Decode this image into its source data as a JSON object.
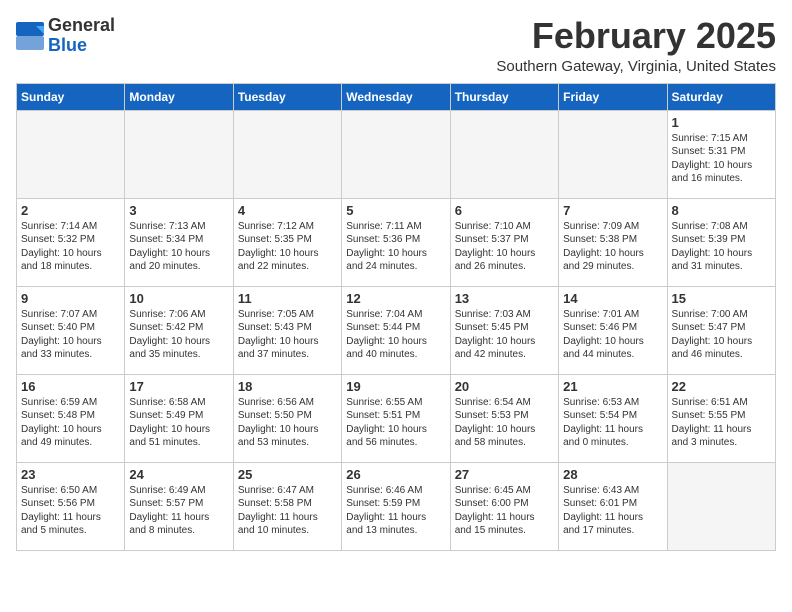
{
  "header": {
    "logo_line1": "General",
    "logo_line2": "Blue",
    "month_title": "February 2025",
    "location": "Southern Gateway, Virginia, United States"
  },
  "days_of_week": [
    "Sunday",
    "Monday",
    "Tuesday",
    "Wednesday",
    "Thursday",
    "Friday",
    "Saturday"
  ],
  "weeks": [
    [
      {
        "day": "",
        "info": ""
      },
      {
        "day": "",
        "info": ""
      },
      {
        "day": "",
        "info": ""
      },
      {
        "day": "",
        "info": ""
      },
      {
        "day": "",
        "info": ""
      },
      {
        "day": "",
        "info": ""
      },
      {
        "day": "1",
        "info": "Sunrise: 7:15 AM\nSunset: 5:31 PM\nDaylight: 10 hours\nand 16 minutes."
      }
    ],
    [
      {
        "day": "2",
        "info": "Sunrise: 7:14 AM\nSunset: 5:32 PM\nDaylight: 10 hours\nand 18 minutes."
      },
      {
        "day": "3",
        "info": "Sunrise: 7:13 AM\nSunset: 5:34 PM\nDaylight: 10 hours\nand 20 minutes."
      },
      {
        "day": "4",
        "info": "Sunrise: 7:12 AM\nSunset: 5:35 PM\nDaylight: 10 hours\nand 22 minutes."
      },
      {
        "day": "5",
        "info": "Sunrise: 7:11 AM\nSunset: 5:36 PM\nDaylight: 10 hours\nand 24 minutes."
      },
      {
        "day": "6",
        "info": "Sunrise: 7:10 AM\nSunset: 5:37 PM\nDaylight: 10 hours\nand 26 minutes."
      },
      {
        "day": "7",
        "info": "Sunrise: 7:09 AM\nSunset: 5:38 PM\nDaylight: 10 hours\nand 29 minutes."
      },
      {
        "day": "8",
        "info": "Sunrise: 7:08 AM\nSunset: 5:39 PM\nDaylight: 10 hours\nand 31 minutes."
      }
    ],
    [
      {
        "day": "9",
        "info": "Sunrise: 7:07 AM\nSunset: 5:40 PM\nDaylight: 10 hours\nand 33 minutes."
      },
      {
        "day": "10",
        "info": "Sunrise: 7:06 AM\nSunset: 5:42 PM\nDaylight: 10 hours\nand 35 minutes."
      },
      {
        "day": "11",
        "info": "Sunrise: 7:05 AM\nSunset: 5:43 PM\nDaylight: 10 hours\nand 37 minutes."
      },
      {
        "day": "12",
        "info": "Sunrise: 7:04 AM\nSunset: 5:44 PM\nDaylight: 10 hours\nand 40 minutes."
      },
      {
        "day": "13",
        "info": "Sunrise: 7:03 AM\nSunset: 5:45 PM\nDaylight: 10 hours\nand 42 minutes."
      },
      {
        "day": "14",
        "info": "Sunrise: 7:01 AM\nSunset: 5:46 PM\nDaylight: 10 hours\nand 44 minutes."
      },
      {
        "day": "15",
        "info": "Sunrise: 7:00 AM\nSunset: 5:47 PM\nDaylight: 10 hours\nand 46 minutes."
      }
    ],
    [
      {
        "day": "16",
        "info": "Sunrise: 6:59 AM\nSunset: 5:48 PM\nDaylight: 10 hours\nand 49 minutes."
      },
      {
        "day": "17",
        "info": "Sunrise: 6:58 AM\nSunset: 5:49 PM\nDaylight: 10 hours\nand 51 minutes."
      },
      {
        "day": "18",
        "info": "Sunrise: 6:56 AM\nSunset: 5:50 PM\nDaylight: 10 hours\nand 53 minutes."
      },
      {
        "day": "19",
        "info": "Sunrise: 6:55 AM\nSunset: 5:51 PM\nDaylight: 10 hours\nand 56 minutes."
      },
      {
        "day": "20",
        "info": "Sunrise: 6:54 AM\nSunset: 5:53 PM\nDaylight: 10 hours\nand 58 minutes."
      },
      {
        "day": "21",
        "info": "Sunrise: 6:53 AM\nSunset: 5:54 PM\nDaylight: 11 hours\nand 0 minutes."
      },
      {
        "day": "22",
        "info": "Sunrise: 6:51 AM\nSunset: 5:55 PM\nDaylight: 11 hours\nand 3 minutes."
      }
    ],
    [
      {
        "day": "23",
        "info": "Sunrise: 6:50 AM\nSunset: 5:56 PM\nDaylight: 11 hours\nand 5 minutes."
      },
      {
        "day": "24",
        "info": "Sunrise: 6:49 AM\nSunset: 5:57 PM\nDaylight: 11 hours\nand 8 minutes."
      },
      {
        "day": "25",
        "info": "Sunrise: 6:47 AM\nSunset: 5:58 PM\nDaylight: 11 hours\nand 10 minutes."
      },
      {
        "day": "26",
        "info": "Sunrise: 6:46 AM\nSunset: 5:59 PM\nDaylight: 11 hours\nand 13 minutes."
      },
      {
        "day": "27",
        "info": "Sunrise: 6:45 AM\nSunset: 6:00 PM\nDaylight: 11 hours\nand 15 minutes."
      },
      {
        "day": "28",
        "info": "Sunrise: 6:43 AM\nSunset: 6:01 PM\nDaylight: 11 hours\nand 17 minutes."
      },
      {
        "day": "",
        "info": ""
      }
    ]
  ]
}
